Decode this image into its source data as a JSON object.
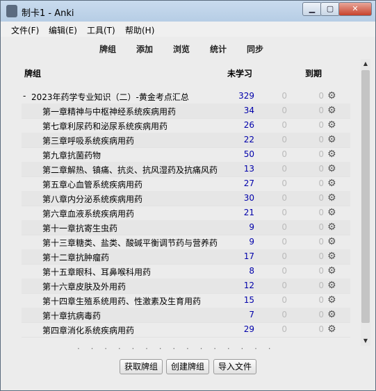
{
  "window": {
    "title": "制卡1 - Anki",
    "min_label": "▁",
    "max_label": "▢",
    "close_label": "✕"
  },
  "menubar": {
    "items": [
      "文件(F)",
      "编辑(E)",
      "工具(T)",
      "帮助(H)"
    ]
  },
  "toolbar": {
    "links": [
      "牌组",
      "添加",
      "浏览",
      "统计",
      "同步"
    ]
  },
  "table": {
    "headers": {
      "deck": "牌组",
      "new": "未学习",
      "due": "到期"
    },
    "parent": {
      "toggle": "-",
      "name": "2023年药学专业知识（二）-黄金考点汇总",
      "new": "329",
      "learn": "0",
      "due": "0"
    },
    "children": [
      {
        "name": "第一章精神与中枢神经系统疾病用药",
        "new": "34",
        "learn": "0",
        "due": "0"
      },
      {
        "name": "第七章利尿药和泌尿系统疾病用药",
        "new": "26",
        "learn": "0",
        "due": "0"
      },
      {
        "name": "第三章呼吸系统疾病用药",
        "new": "22",
        "learn": "0",
        "due": "0"
      },
      {
        "name": "第九章抗菌药物",
        "new": "50",
        "learn": "0",
        "due": "0"
      },
      {
        "name": "第二章解热、镇痛、抗炎、抗风湿药及抗痛风药",
        "new": "13",
        "learn": "0",
        "due": "0"
      },
      {
        "name": "第五章心血管系统疾病用药",
        "new": "27",
        "learn": "0",
        "due": "0"
      },
      {
        "name": "第八章内分泌系统疾病用药",
        "new": "30",
        "learn": "0",
        "due": "0"
      },
      {
        "name": "第六章血液系统疾病用药",
        "new": "21",
        "learn": "0",
        "due": "0"
      },
      {
        "name": "第十一章抗寄生虫药",
        "new": "9",
        "learn": "0",
        "due": "0"
      },
      {
        "name": "第十三章糖类、盐类、酸碱平衡调节药与营养药",
        "new": "9",
        "learn": "0",
        "due": "0"
      },
      {
        "name": "第十二章抗肿瘤药",
        "new": "17",
        "learn": "0",
        "due": "0"
      },
      {
        "name": "第十五章眼科、耳鼻喉科用药",
        "new": "8",
        "learn": "0",
        "due": "0"
      },
      {
        "name": "第十六章皮肤及外用药",
        "new": "12",
        "learn": "0",
        "due": "0"
      },
      {
        "name": "第十四章生殖系统用药、性激素及生育用药",
        "new": "15",
        "learn": "0",
        "due": "0"
      },
      {
        "name": "第十章抗病毒药",
        "new": "7",
        "learn": "0",
        "due": "0"
      },
      {
        "name": "第四章消化系统疾病用药",
        "new": "29",
        "learn": "0",
        "due": "0"
      }
    ]
  },
  "icons": {
    "gear": "gear-icon",
    "scroll_up": "▲",
    "scroll_down": "▼"
  },
  "buttons": {
    "get_shared": "获取牌组",
    "create_deck": "创建牌组",
    "import_file": "导入文件"
  }
}
